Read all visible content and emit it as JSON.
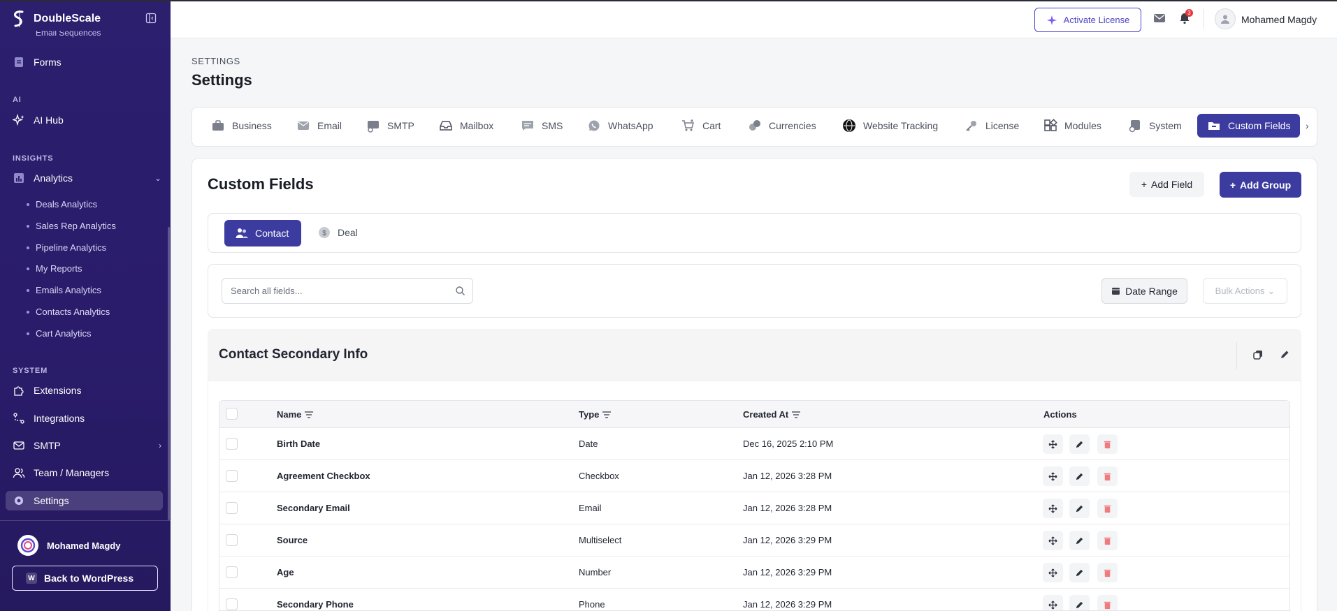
{
  "brand": {
    "name": "DoubleScale"
  },
  "sidebar": {
    "partial_item": "Email Sequences",
    "items": [
      {
        "label": "Forms",
        "icon": "form-icon"
      },
      {
        "label": "AI Hub",
        "icon": "sparkle-icon"
      },
      {
        "label": "Analytics",
        "icon": "chart-icon"
      },
      {
        "label": "Extensions",
        "icon": "puzzle-icon"
      },
      {
        "label": "Integrations",
        "icon": "integrations-icon"
      },
      {
        "label": "SMTP",
        "icon": "mail-icon"
      },
      {
        "label": "Team / Managers",
        "icon": "users-icon"
      },
      {
        "label": "Settings",
        "icon": "gear-icon"
      }
    ],
    "sections": {
      "ai": "AI",
      "insights": "INSIGHTS",
      "system": "SYSTEM"
    },
    "analytics_sub": [
      "Deals Analytics",
      "Sales Rep Analytics",
      "Pipeline Analytics",
      "My Reports",
      "Emails Analytics",
      "Contacts Analytics",
      "Cart Analytics"
    ],
    "user_name": "Mohamed Magdy",
    "back_wp": "Back to WordPress"
  },
  "topbar": {
    "activate_label": "Activate License",
    "notification_count": "3",
    "user_name": "Mohamed Magdy"
  },
  "page": {
    "breadcrumb": "SETTINGS",
    "title": "Settings"
  },
  "tabs": [
    "Business",
    "Email",
    "SMTP",
    "Mailbox",
    "SMS",
    "WhatsApp",
    "Cart",
    "Currencies",
    "Website Tracking",
    "License",
    "Modules",
    "System",
    "Custom Fields"
  ],
  "custom_fields": {
    "title": "Custom Fields",
    "add_field": "Add Field",
    "add_group": "Add Group",
    "subtabs": [
      "Contact",
      "Deal"
    ],
    "search_placeholder": "Search all fields...",
    "date_range": "Date Range",
    "bulk_actions": "Bulk Actions",
    "group_title": "Contact Secondary Info",
    "columns": [
      "Name",
      "Type",
      "Created At",
      "Actions"
    ],
    "rows": [
      {
        "name": "Birth Date",
        "type": "Date",
        "created": "Dec 16, 2025 2:10 PM"
      },
      {
        "name": "Agreement Checkbox",
        "type": "Checkbox",
        "created": "Jan 12, 2026 3:28 PM"
      },
      {
        "name": "Secondary Email",
        "type": "Email",
        "created": "Jan 12, 2026 3:28 PM"
      },
      {
        "name": "Source",
        "type": "Multiselect",
        "created": "Jan 12, 2026 3:29 PM"
      },
      {
        "name": "Age",
        "type": "Number",
        "created": "Jan 12, 2026 3:29 PM"
      },
      {
        "name": "Secondary Phone",
        "type": "Phone",
        "created": "Jan 12, 2026 3:29 PM"
      }
    ]
  },
  "colors": {
    "sidebar": "#2b1f6e",
    "accent": "#3c3ba0",
    "danger": "#e4363b"
  }
}
